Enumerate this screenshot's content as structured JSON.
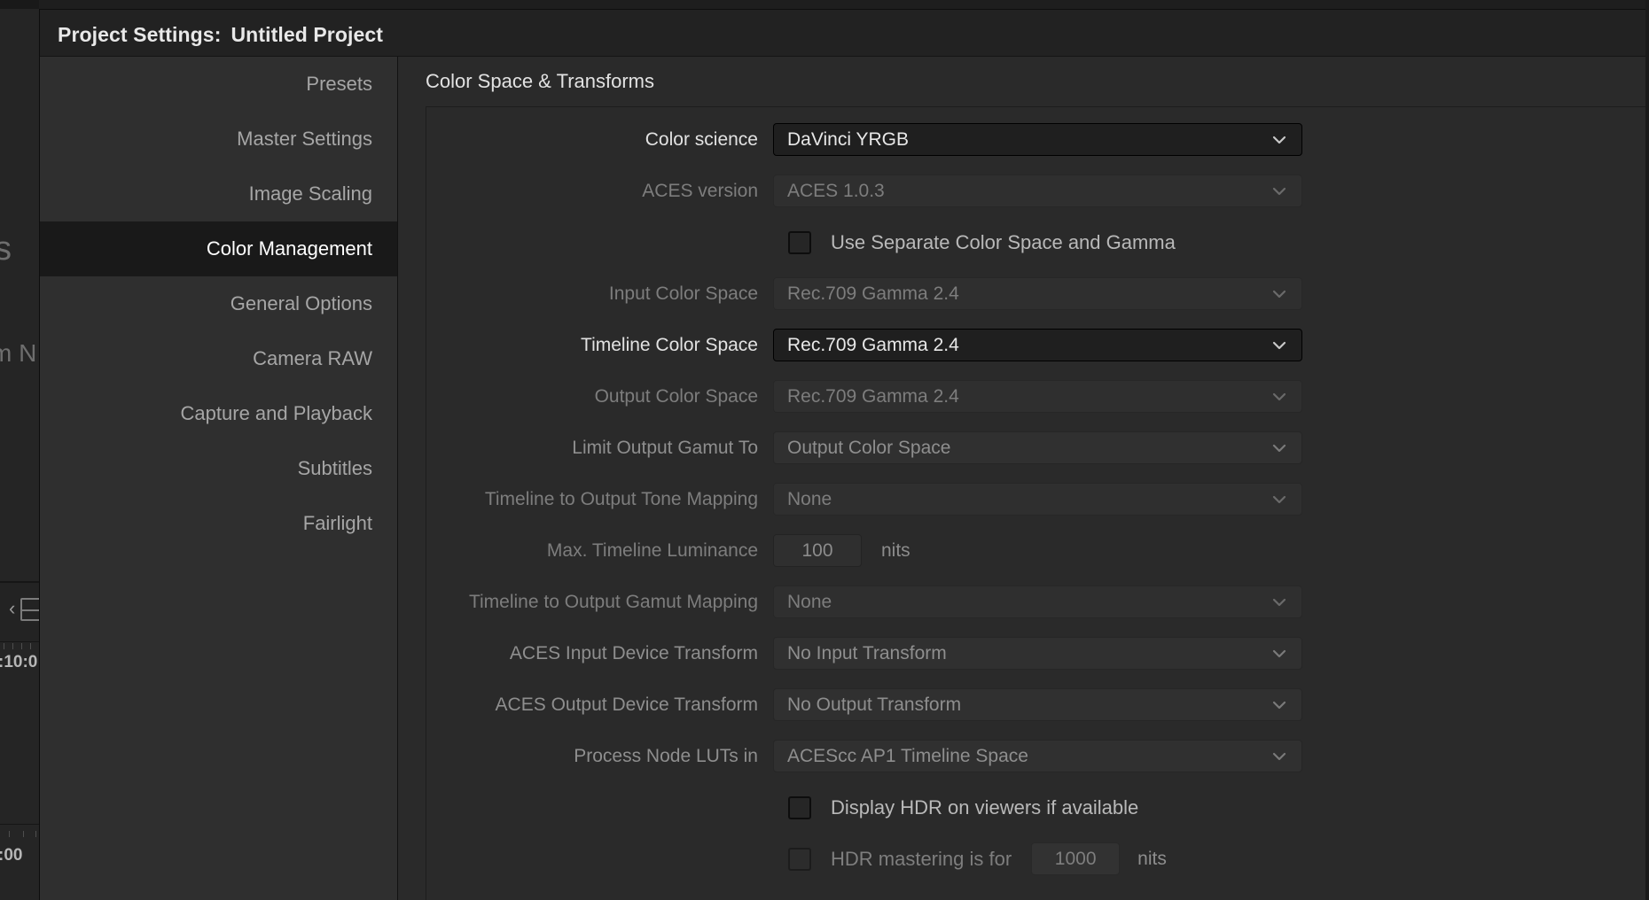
{
  "window": {
    "title_prefix": "Project Settings:",
    "project_name": "Untitled Project"
  },
  "sidebar": {
    "items": [
      {
        "label": "Presets",
        "selected": false
      },
      {
        "label": "Master Settings",
        "selected": false
      },
      {
        "label": "Image Scaling",
        "selected": false
      },
      {
        "label": "Color Management",
        "selected": true
      },
      {
        "label": "General Options",
        "selected": false
      },
      {
        "label": "Camera RAW",
        "selected": false
      },
      {
        "label": "Capture and Playback",
        "selected": false
      },
      {
        "label": "Subtitles",
        "selected": false
      },
      {
        "label": "Fairlight",
        "selected": false
      }
    ]
  },
  "content": {
    "section_title": "Color Space & Transforms",
    "rows": [
      {
        "label": "Color science",
        "value": "DaVinci YRGB",
        "state": "enabled"
      },
      {
        "label": "ACES version",
        "value": "ACES 1.0.3",
        "state": "dim"
      },
      {
        "label": "Input Color Space",
        "value": "Rec.709 Gamma 2.4",
        "state": "dim"
      },
      {
        "label": "Timeline Color Space",
        "value": "Rec.709 Gamma 2.4",
        "state": "enabled"
      },
      {
        "label": "Output Color Space",
        "value": "Rec.709 Gamma 2.4",
        "state": "dim"
      },
      {
        "label": "Limit Output Gamut To",
        "value": "Output Color Space",
        "state": "dim2"
      },
      {
        "label": "Timeline to Output Tone Mapping",
        "value": "None",
        "state": "dim"
      },
      {
        "label": "Timeline to Output Gamut Mapping",
        "value": "None",
        "state": "dim"
      },
      {
        "label": "ACES Input Device Transform",
        "value": "No Input Transform",
        "state": "dim2"
      },
      {
        "label": "ACES Output Device Transform",
        "value": "No Output Transform",
        "state": "dim2"
      },
      {
        "label": "Process Node LUTs in",
        "value": "ACEScc AP1 Timeline Space",
        "state": "dim2"
      }
    ],
    "luminance_row": {
      "label": "Max. Timeline Luminance",
      "value": "100",
      "unit": "nits"
    },
    "checkbox_separate": {
      "label": "Use Separate Color Space and Gamma",
      "checked": false
    },
    "checkbox_hdr_viewers": {
      "label": "Display HDR on viewers if available",
      "checked": false
    },
    "checkbox_hdr_mastering": {
      "label": "HDR mastering is for",
      "value": "1000",
      "unit": "nits",
      "checked": false
    }
  },
  "background": {
    "ghost_text_1": "s",
    "ghost_text_2": "m N",
    "timecode_1": ":10:0",
    "timecode_2": ":00"
  },
  "colors": {
    "dialog_bg": "#2a2a2a",
    "sidebar_bg": "#2f2f2f",
    "titlebar_bg": "#222222",
    "selected_bg": "#191919",
    "field_bg": "#333333",
    "field_bg_active": "#1f1f1f",
    "text_primary": "#e8e8e8",
    "text_secondary": "#bdbdbd",
    "text_disabled": "#7d7d7d"
  }
}
